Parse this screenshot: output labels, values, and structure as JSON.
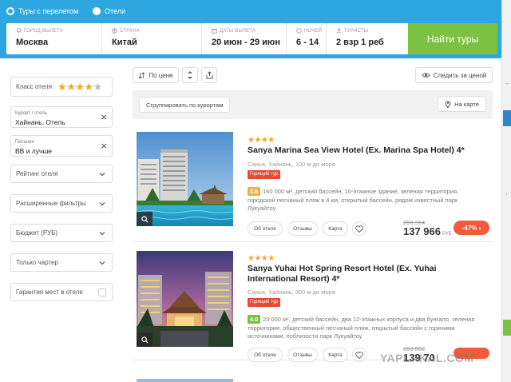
{
  "search": {
    "radio_tours": "Туры с перелетом",
    "radio_hotels": "Отели",
    "fields": [
      {
        "label": "Город вылета",
        "value": "Москва"
      },
      {
        "label": "Страна",
        "value": "Китай"
      },
      {
        "label": "Даты вылета",
        "value": "20 июн - 29 июн"
      },
      {
        "label": "Ночей",
        "value": "6 - 14"
      },
      {
        "label": "Туристы",
        "value": "2 взр 1 реб"
      }
    ],
    "button": "Найти туры",
    "accent": "#2ea7e0",
    "button_color": "#7cc242"
  },
  "filters": {
    "hotel_class": {
      "label": "Класс отеля",
      "stars_on": 4,
      "stars_total": 5
    },
    "resort": {
      "label": "Курорт / отель",
      "value": "Хайнань, Отель"
    },
    "meal": {
      "label": "Питание",
      "value": "BB и лучше"
    },
    "dropdowns": [
      "Рейтинг отеля",
      "Расширенные фильтры",
      "Бюджет (РУБ)",
      "Только чартер"
    ],
    "guarantee": "Гарантия мест в отеле"
  },
  "toolbar": {
    "sort": "По цене",
    "watch": "Следить за ценой",
    "group": "Сгруппировать по курортам",
    "map": "На карте"
  },
  "hotels": [
    {
      "stars": "★★★★",
      "name": "Sanya Marina Sea View Hotel (Ex. Marina Spa Hotel) 4*",
      "location": "Санья, Хайнань, 100 м до моря",
      "badge": "Горящий тур",
      "rating": "3.6",
      "rating_color": "#e8b34a",
      "desc": "160 000 м², детский бассейн, 10-этажное здание, зеленая территория, городской песчаный пляж в 4 км, открытый бассейн, рядом известный парк Лукуайтоу",
      "btn_about": "Об отеле",
      "btn_reviews": "Отзывы",
      "btn_map": "Карта",
      "old_price": "260 314",
      "price": "137 966",
      "currency": "РУБ",
      "discount": "-47%"
    },
    {
      "stars": "★★★★",
      "name": "Sanya Yuhai Hot Spring Resort Hotel (Ex. Yuhai International Resort) 4*",
      "location": "Санья, Хайнань, 300 м до моря",
      "badge": "Горящий тур",
      "rating": "4.0",
      "rating_color": "#7cc242",
      "desc": "23 000 м², детский бассейн, два 12-этажных корпуса и два бунгало, зеленая территория, общественный песчаный пляж, открытый бассейн с горячими источниками, поблизости парк Лукуайтоу",
      "btn_about": "Об отеле",
      "btn_reviews": "Отзывы",
      "btn_map": "Карта",
      "old_price": "263 552",
      "price": "139 70",
      "currency": "",
      "discount": ""
    }
  ],
  "watermark": "YAPLAKAL.COM"
}
